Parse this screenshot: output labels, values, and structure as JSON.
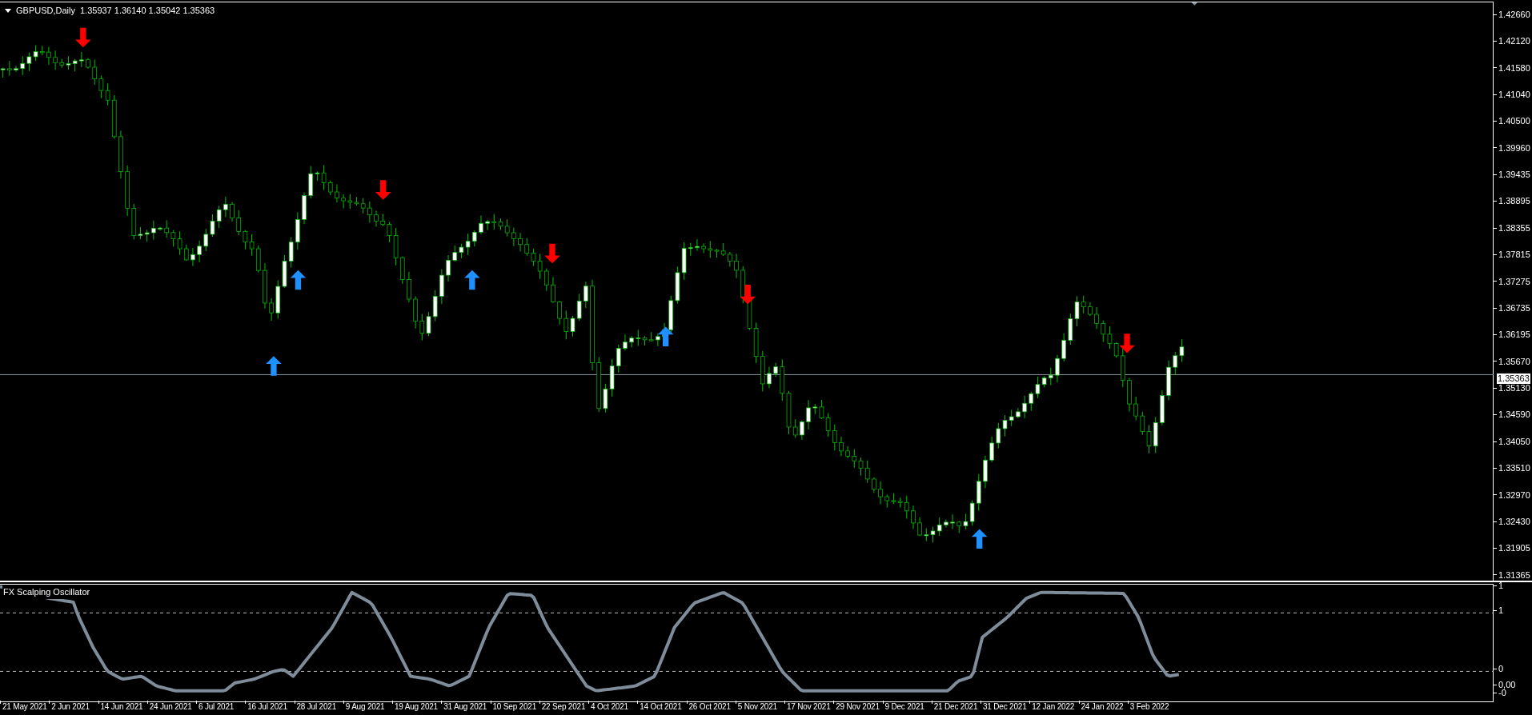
{
  "chart": {
    "symbol": "GBPUSD,Daily",
    "ohlc": [
      "1.35937",
      "1.36140",
      "1.35042",
      "1.35363"
    ],
    "current_price": "1.35363",
    "price_axis": [
      "1.42660",
      "1.42120",
      "1.41580",
      "1.41040",
      "1.40500",
      "1.39960",
      "1.39435",
      "1.38895",
      "1.38355",
      "1.37815",
      "1.37275",
      "1.36735",
      "1.36195",
      "1.35670",
      "1.35130",
      "1.34590",
      "1.34050",
      "1.33510",
      "1.32970",
      "1.32430",
      "1.31905",
      "1.31365"
    ]
  },
  "oscillator": {
    "title": "FX Scalping Oscillator",
    "axis": [
      "1",
      "1",
      "0",
      "0,00",
      "-0"
    ]
  },
  "time_axis": [
    "21 May 2021",
    "2 Jun 2021",
    "14 Jun 2021",
    "24 Jun 2021",
    "6 Jul 2021",
    "16 Jul 2021",
    "28 Jul 2021",
    "9 Aug 2021",
    "19 Aug 2021",
    "31 Aug 2021",
    "10 Sep 2021",
    "22 Sep 2021",
    "4 Oct 2021",
    "14 Oct 2021",
    "26 Oct 2021",
    "5 Nov 2021",
    "17 Nov 2021",
    "29 Nov 2021",
    "9 Dec 2021",
    "21 Dec 2021",
    "31 Dec 2021",
    "12 Jan 2022",
    "24 Jan 2022",
    "3 Feb 2022"
  ]
}
